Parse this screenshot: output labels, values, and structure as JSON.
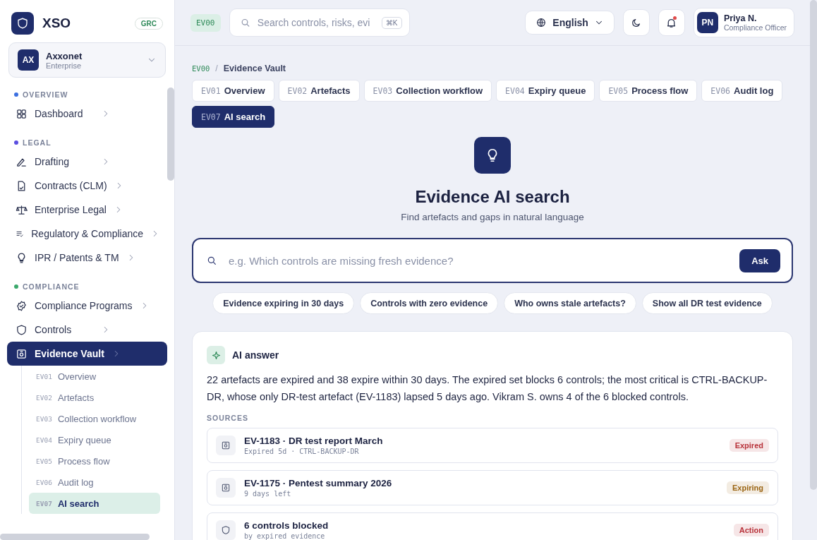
{
  "brand": {
    "name": "XSO",
    "badge": "GRC"
  },
  "org": {
    "initials": "AX",
    "name": "Axxonet",
    "plan": "Enterprise"
  },
  "nav": [
    {
      "title": "OVERVIEW",
      "color": "#3b6fe0",
      "items": [
        {
          "label": "Dashboard",
          "selected": false
        }
      ]
    },
    {
      "title": "LEGAL",
      "color": "#5b4ee0",
      "items": [
        {
          "label": "Drafting",
          "selected": false
        },
        {
          "label": "Contracts (CLM)",
          "selected": false
        },
        {
          "label": "Enterprise Legal",
          "selected": false
        },
        {
          "label": "Regulatory & Compliance",
          "selected": false
        },
        {
          "label": "IPR / Patents & TM",
          "selected": false
        }
      ]
    },
    {
      "title": "COMPLIANCE",
      "color": "#3aa86b",
      "items": [
        {
          "label": "Compliance Programs",
          "selected": false
        },
        {
          "label": "Controls",
          "selected": false
        },
        {
          "label": "Evidence Vault",
          "selected": true,
          "children": [
            {
              "code": "EV01",
              "label": "Overview",
              "selected": false
            },
            {
              "code": "EV02",
              "label": "Artefacts",
              "selected": false
            },
            {
              "code": "EV03",
              "label": "Collection workflow",
              "selected": false
            },
            {
              "code": "EV04",
              "label": "Expiry queue",
              "selected": false
            },
            {
              "code": "EV05",
              "label": "Process flow",
              "selected": false
            },
            {
              "code": "EV06",
              "label": "Audit log",
              "selected": false
            },
            {
              "code": "EV07",
              "label": "AI search",
              "selected": true
            }
          ]
        }
      ]
    }
  ],
  "topbar": {
    "code": "EV00",
    "search": {
      "placeholder": "Search controls, risks, evi",
      "shortcut": "⌘K"
    },
    "language": "English",
    "unread": true,
    "user": {
      "initials": "PN",
      "name": "Priya N.",
      "role": "Compliance Officer"
    }
  },
  "breadcrumb": {
    "code": "EV00",
    "separator": "/",
    "current": "Evidence Vault"
  },
  "tabs": [
    {
      "code": "EV01",
      "label": "Overview",
      "selected": false
    },
    {
      "code": "EV02",
      "label": "Artefacts",
      "selected": false
    },
    {
      "code": "EV03",
      "label": "Collection workflow",
      "selected": false
    },
    {
      "code": "EV04",
      "label": "Expiry queue",
      "selected": false
    },
    {
      "code": "EV05",
      "label": "Process flow",
      "selected": false
    },
    {
      "code": "EV06",
      "label": "Audit log",
      "selected": false
    },
    {
      "code": "EV07",
      "label": "AI search",
      "selected": true
    }
  ],
  "hero": {
    "title": "Evidence AI search",
    "subtitle": "Find artefacts and gaps in natural language"
  },
  "ask": {
    "placeholder": "e.g. Which controls are missing fresh evidence?",
    "button": "Ask"
  },
  "suggestions": [
    "Evidence expiring in 30 days",
    "Controls with zero evidence",
    "Who owns stale artefacts?",
    "Show all DR test evidence"
  ],
  "answer": {
    "title": "AI answer",
    "text": "22 artefacts are expired and 38 expire within 30 days. The expired set blocks 6 controls; the most critical is CTRL-BACKUP-DR, whose only DR-test artefact (EV-1183) lapsed 5 days ago. Vikram S. owns 4 of the 6 blocked controls.",
    "sources_label": "SOURCES",
    "sources": [
      {
        "kind": "artefact",
        "title": "EV-1183 · DR test report March",
        "meta": "Expired 5d · CTRL-BACKUP-DR",
        "status": "Expired",
        "color": "#b8323a"
      },
      {
        "kind": "artefact",
        "title": "EV-1175 · Pentest summary 2026",
        "meta": "9 days left",
        "status": "Expiring",
        "color": "#9a6412"
      },
      {
        "kind": "control",
        "title": "6 controls blocked",
        "meta": "by expired evidence",
        "status": "Action",
        "color": "#b8323a"
      }
    ]
  }
}
